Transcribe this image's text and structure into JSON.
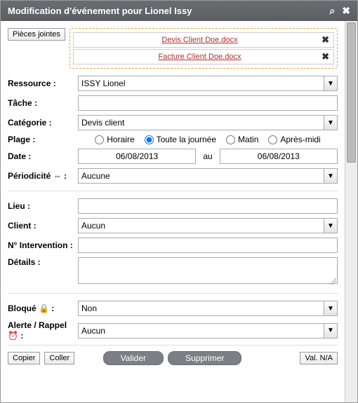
{
  "title": "Modification d'événement pour Lionel Issy",
  "attachments": {
    "button_label": "Pièces jointes",
    "items": [
      {
        "name": "Devis Client Doe.docx"
      },
      {
        "name": "Facture Client Doe.docx"
      }
    ]
  },
  "labels": {
    "ressource": "Ressource :",
    "tache": "Tâche :",
    "categorie": "Catégorie :",
    "plage": "Plage :",
    "date": "Date :",
    "date_au": "au",
    "periodicite": "Périodicité ⇔ :",
    "lieu": "Lieu :",
    "client": "Client :",
    "intervention": "N° Intervention :",
    "details": "Détails :",
    "bloque": "Bloqué 🔒 :",
    "alerte": "Alerte / Rappel ⏰ :"
  },
  "values": {
    "ressource": "ISSY Lionel",
    "tache": "",
    "categorie": "Devis client",
    "date_start": "06/08/2013",
    "date_end": "06/08/2013",
    "periodicite": "Aucune",
    "lieu": "",
    "client": "Aucun",
    "intervention": "",
    "details": "",
    "bloque": "Non",
    "alerte": "Aucun"
  },
  "plage_options": {
    "horaire": "Horaire",
    "journee": "Toute la journée",
    "matin": "Matin",
    "apresmidi": "Après-midi",
    "selected": "journee"
  },
  "footer": {
    "copier": "Copier",
    "coller": "Coller",
    "valider": "Valider",
    "supprimer": "Supprimer",
    "val_na": "Val. N/A"
  }
}
